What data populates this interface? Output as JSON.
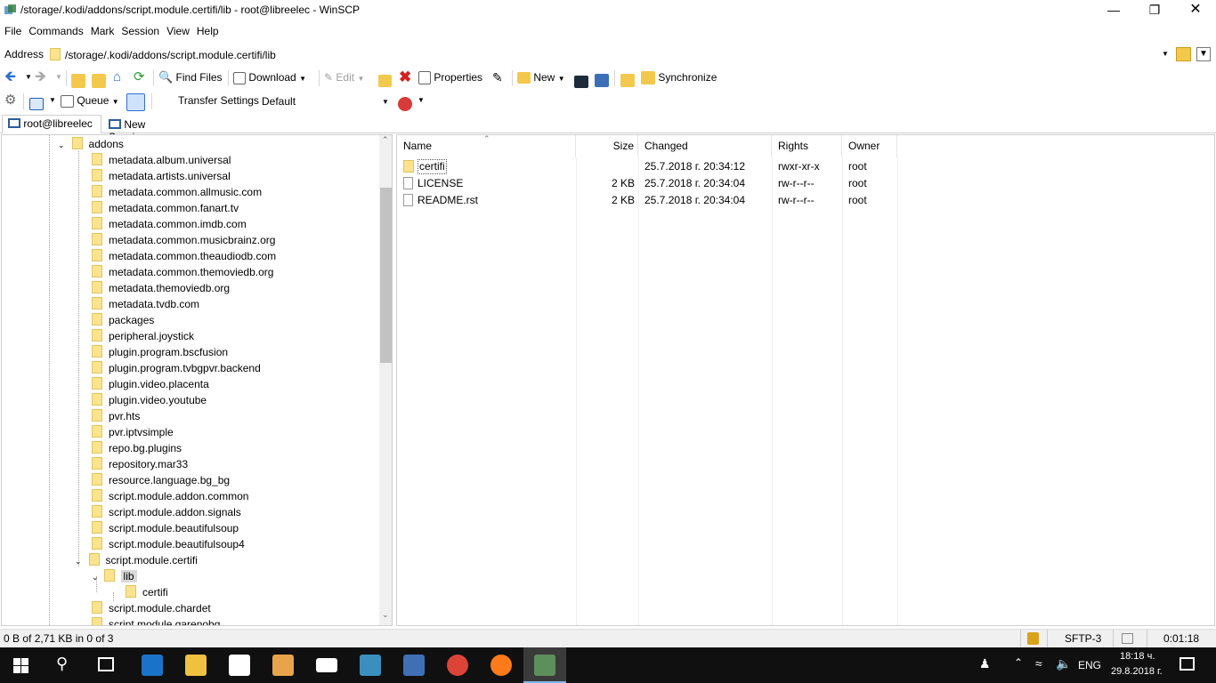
{
  "window": {
    "title": "/storage/.kodi/addons/script.module.certifi/lib - root@libreelec - WinSCP"
  },
  "menu": [
    "File",
    "Commands",
    "Mark",
    "Session",
    "View",
    "Help"
  ],
  "address": {
    "label": "Address",
    "value": "/storage/.kodi/addons/script.module.certifi/lib"
  },
  "toolbar": {
    "find_files": "Find Files",
    "download": "Download",
    "edit": "Edit",
    "properties": "Properties",
    "new": "New",
    "synchronize": "Synchronize",
    "queue": "Queue",
    "transfer_settings_label": "Transfer Settings",
    "transfer_settings_value": "Default"
  },
  "tabs": {
    "session": "root@libreelec",
    "new_session": "New Session"
  },
  "tree": {
    "root": "addons",
    "items": [
      "metadata.album.universal",
      "metadata.artists.universal",
      "metadata.common.allmusic.com",
      "metadata.common.fanart.tv",
      "metadata.common.imdb.com",
      "metadata.common.musicbrainz.org",
      "metadata.common.theaudiodb.com",
      "metadata.common.themoviedb.org",
      "metadata.themoviedb.org",
      "metadata.tvdb.com",
      "packages",
      "peripheral.joystick",
      "plugin.program.bscfusion",
      "plugin.program.tvbgpvr.backend",
      "plugin.video.placenta",
      "plugin.video.youtube",
      "pvr.hts",
      "pvr.iptvsimple",
      "repo.bg.plugins",
      "repository.mar33",
      "resource.language.bg_bg",
      "script.module.addon.common",
      "script.module.addon.signals",
      "script.module.beautifulsoup",
      "script.module.beautifulsoup4",
      "script.module.certifi"
    ],
    "lib": "lib",
    "certifi": "certifi",
    "after": [
      "script.module.chardet",
      "script.module.garenobg"
    ]
  },
  "columns": {
    "name": "Name",
    "size": "Size",
    "changed": "Changed",
    "rights": "Rights",
    "owner": "Owner"
  },
  "files": [
    {
      "name": "certifi",
      "size": "",
      "changed": "25.7.2018 г. 20:34:12",
      "rights": "rwxr-xr-x",
      "owner": "root",
      "type": "folder"
    },
    {
      "name": "LICENSE",
      "size": "2 KB",
      "changed": "25.7.2018 г. 20:34:04",
      "rights": "rw-r--r--",
      "owner": "root",
      "type": "file"
    },
    {
      "name": "README.rst",
      "size": "2 KB",
      "changed": "25.7.2018 г. 20:34:04",
      "rights": "rw-r--r--",
      "owner": "root",
      "type": "file"
    }
  ],
  "status": {
    "summary": "0 B of 2,71 KB in 0 of 3",
    "protocol": "SFTP-3",
    "time": "0:01:18"
  },
  "taskbar": {
    "lang": "ENG",
    "time": "18:18 ч.",
    "date": "29.8.2018 г."
  }
}
